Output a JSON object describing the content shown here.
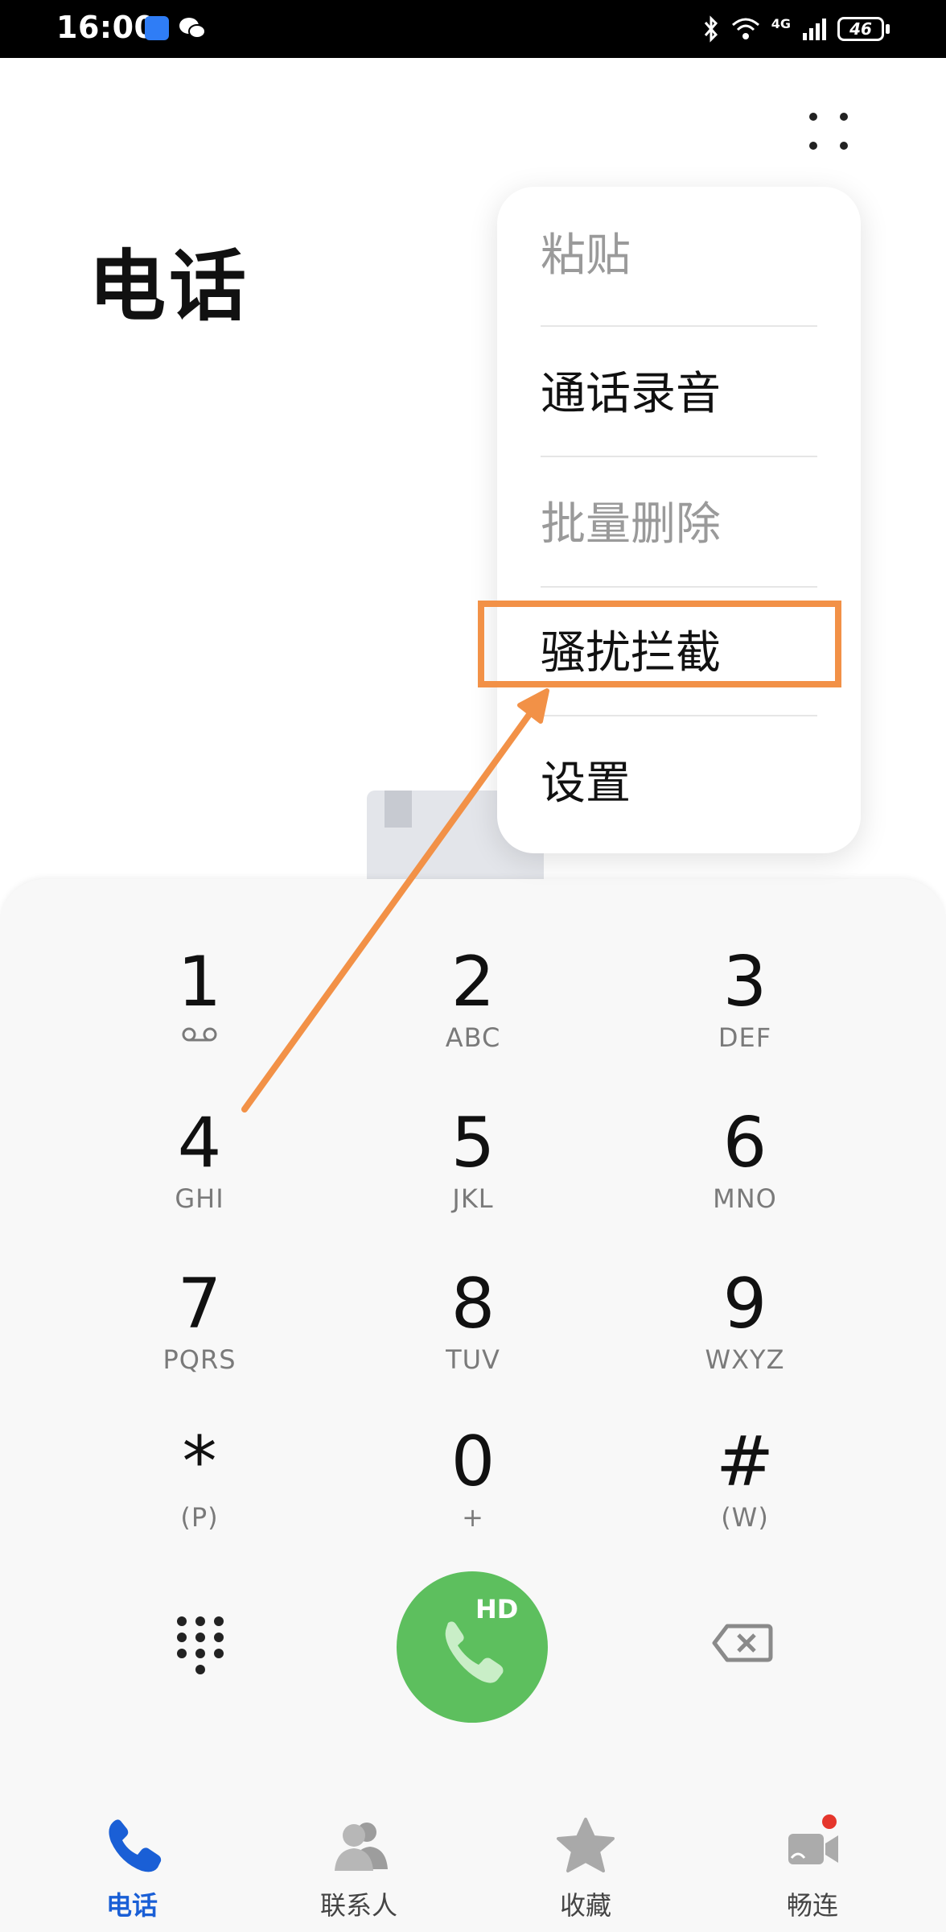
{
  "status_bar": {
    "time": "16:00",
    "network": "4G",
    "battery": "46"
  },
  "header": {
    "title": "电话"
  },
  "menu": {
    "items": [
      {
        "label": "粘贴",
        "enabled": false
      },
      {
        "label": "通话录音",
        "enabled": true
      },
      {
        "label": "批量删除",
        "enabled": false
      },
      {
        "label": "骚扰拦截",
        "enabled": true,
        "highlighted": true
      },
      {
        "label": "设置",
        "enabled": true
      }
    ]
  },
  "dialpad": {
    "keys": [
      {
        "digit": "1",
        "sub": ""
      },
      {
        "digit": "2",
        "sub": "ABC"
      },
      {
        "digit": "3",
        "sub": "DEF"
      },
      {
        "digit": "4",
        "sub": "GHI"
      },
      {
        "digit": "5",
        "sub": "JKL"
      },
      {
        "digit": "6",
        "sub": "MNO"
      },
      {
        "digit": "7",
        "sub": "PQRS"
      },
      {
        "digit": "8",
        "sub": "TUV"
      },
      {
        "digit": "9",
        "sub": "WXYZ"
      },
      {
        "digit": "*",
        "sub": "(P)"
      },
      {
        "digit": "0",
        "sub": "+"
      },
      {
        "digit": "#",
        "sub": "(W)"
      }
    ],
    "call_label": "HD"
  },
  "bottom_nav": {
    "items": [
      {
        "label": "电话",
        "icon": "phone-icon",
        "active": true
      },
      {
        "label": "联系人",
        "icon": "contacts-icon",
        "active": false
      },
      {
        "label": "收藏",
        "icon": "star-icon",
        "active": false
      },
      {
        "label": "畅连",
        "icon": "video-icon",
        "active": false
      }
    ]
  },
  "colors": {
    "accent": "#1a5fd6",
    "call": "#5dbf5e",
    "annotation": "#f29147"
  }
}
